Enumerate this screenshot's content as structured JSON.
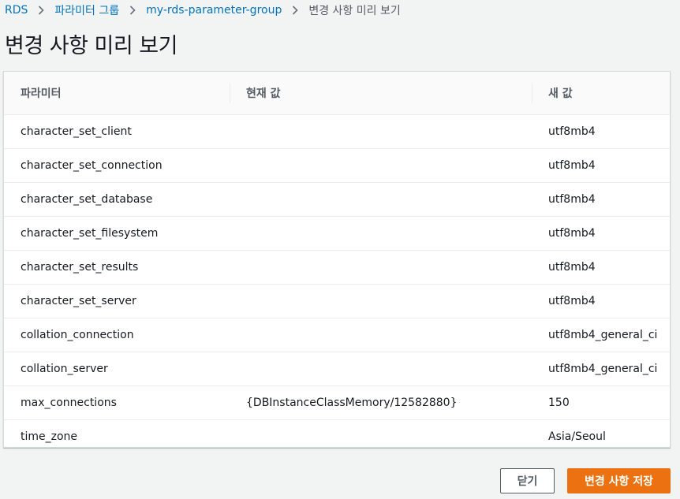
{
  "breadcrumb": {
    "items": [
      "RDS",
      "파라미터 그룹",
      "my-rds-parameter-group"
    ],
    "current": "변경 사항 미리 보기"
  },
  "page": {
    "title": "변경 사항 미리 보기"
  },
  "table": {
    "columns": [
      "파라미터",
      "현재 값",
      "새 값"
    ],
    "rows": [
      [
        "character_set_client",
        "",
        "utf8mb4"
      ],
      [
        "character_set_connection",
        "",
        "utf8mb4"
      ],
      [
        "character_set_database",
        "",
        "utf8mb4"
      ],
      [
        "character_set_filesystem",
        "",
        "utf8mb4"
      ],
      [
        "character_set_results",
        "",
        "utf8mb4"
      ],
      [
        "character_set_server",
        "",
        "utf8mb4"
      ],
      [
        "collation_connection",
        "",
        "utf8mb4_general_ci"
      ],
      [
        "collation_server",
        "",
        "utf8mb4_general_ci"
      ],
      [
        "max_connections",
        "{DBInstanceClassMemory/12582880}",
        "150"
      ],
      [
        "time_zone",
        "",
        "Asia/Seoul"
      ]
    ]
  },
  "actions": {
    "close_label": "닫기",
    "save_label": "변경 사항 저장"
  },
  "colors": {
    "primary": "#ec7211",
    "link": "#0073bb"
  },
  "icons": {
    "separator": "chevron-right-icon"
  }
}
